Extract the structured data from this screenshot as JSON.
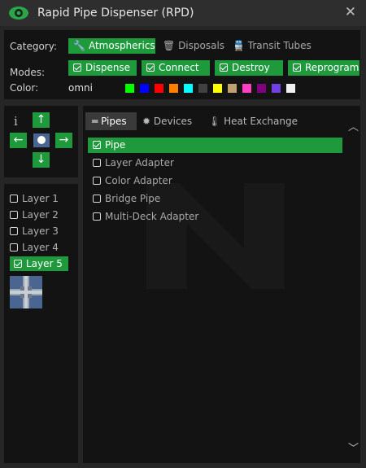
{
  "window": {
    "title": "Rapid Pipe Dispenser (RPD)",
    "close_label": "✕"
  },
  "category": {
    "label": "Category:",
    "items": [
      {
        "label": "Atmospherics",
        "icon": "wrench-icon",
        "active": true
      },
      {
        "label": "Disposals",
        "icon": "trash-icon",
        "active": false
      },
      {
        "label": "Transit Tubes",
        "icon": "train-icon",
        "active": false
      }
    ]
  },
  "modes": {
    "label": "Modes:",
    "items": [
      {
        "label": "Dispense",
        "checked": true
      },
      {
        "label": "Connect",
        "checked": true
      },
      {
        "label": "Destroy",
        "checked": true
      },
      {
        "label": "Reprogram",
        "checked": true
      }
    ]
  },
  "color": {
    "label": "Color:",
    "current": "omni",
    "swatches": [
      "#00ff00",
      "#0000ff",
      "#ff0000",
      "#ff8000",
      "#00ffff",
      "#404040",
      "#ffff00",
      "#c0a070",
      "#ff40c0",
      "#800080",
      "#7040e0",
      "#f0f0f0"
    ]
  },
  "direction": {
    "info_glyph": "i"
  },
  "layers": {
    "items": [
      {
        "label": "Layer 1",
        "checked": false
      },
      {
        "label": "Layer 2",
        "checked": false
      },
      {
        "label": "Layer 3",
        "checked": false
      },
      {
        "label": "Layer 4",
        "checked": false
      },
      {
        "label": "Layer 5",
        "checked": true
      }
    ]
  },
  "tabs": [
    {
      "label": "Pipes",
      "icon": "pipes-icon",
      "active": true
    },
    {
      "label": "Devices",
      "icon": "gear-icon",
      "active": false
    },
    {
      "label": "Heat Exchange",
      "icon": "thermometer-icon",
      "active": false
    }
  ],
  "pipes": [
    {
      "label": "Pipe",
      "checked": true
    },
    {
      "label": "Layer Adapter",
      "checked": false
    },
    {
      "label": "Color Adapter",
      "checked": false
    },
    {
      "label": "Bridge Pipe",
      "checked": false
    },
    {
      "label": "Multi-Deck Adapter",
      "checked": false
    }
  ],
  "colors": {
    "accent": "#1e9a3c",
    "panel": "#131313",
    "frame": "#262626",
    "selected_tab": "#3a3a3a"
  }
}
